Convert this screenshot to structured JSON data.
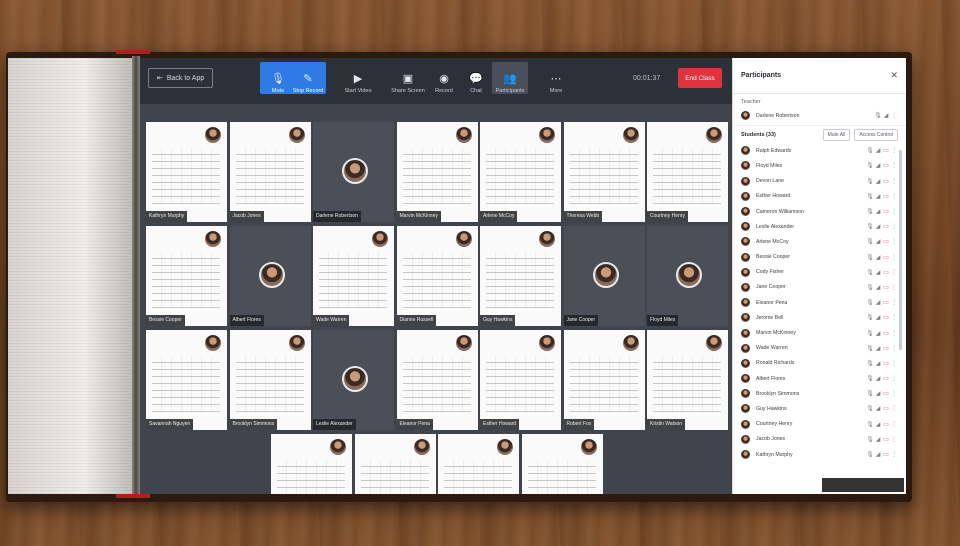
{
  "toolbar": {
    "back_label": "Back to App",
    "tools": [
      {
        "label": "Mute",
        "icon": "microphone-icon",
        "active": true
      },
      {
        "label": "Stop Record",
        "icon": "record-pen-icon",
        "active": true
      },
      {
        "label": "Start Video",
        "icon": "video-camera-icon",
        "active": false
      },
      {
        "label": "Share Screen",
        "icon": "share-screen-icon",
        "active": false
      },
      {
        "label": "Record",
        "icon": "record-icon",
        "active": false
      },
      {
        "label": "Chat",
        "icon": "chat-bubble-icon",
        "active": false
      },
      {
        "label": "Participants",
        "icon": "participants-icon",
        "active": false
      },
      {
        "label": "More",
        "icon": "more-dots-icon",
        "active": false
      }
    ],
    "timer": "00:01:37",
    "end_label": "End Class"
  },
  "grid": {
    "tiles": [
      {
        "name": "Kathryn Murphy",
        "video_off": false
      },
      {
        "name": "Jacob Jones",
        "video_off": false
      },
      {
        "name": "Darlene Robertson",
        "video_off": true
      },
      {
        "name": "Marvin McKinney",
        "video_off": false
      },
      {
        "name": "Arlene McCoy",
        "video_off": false
      },
      {
        "name": "Theresa Webb",
        "video_off": false
      },
      {
        "name": "Courtney Henry",
        "video_off": false
      },
      {
        "name": "Bessie Cooper",
        "video_off": false
      },
      {
        "name": "Albert Flores",
        "video_off": true
      },
      {
        "name": "Wade Warren",
        "video_off": false
      },
      {
        "name": "Dianne Russell",
        "video_off": false
      },
      {
        "name": "Guy Hawkins",
        "video_off": false
      },
      {
        "name": "Jane Cooper",
        "video_off": true
      },
      {
        "name": "Floyd Miles",
        "video_off": true
      },
      {
        "name": "Savannah Nguyen",
        "video_off": false
      },
      {
        "name": "Brooklyn Simmons",
        "video_off": false
      },
      {
        "name": "Leslie Alexander",
        "video_off": true
      },
      {
        "name": "Eleanor Pena",
        "video_off": false
      },
      {
        "name": "Esther Howard",
        "video_off": false
      },
      {
        "name": "Robert Fox",
        "video_off": false
      },
      {
        "name": "Kristin Watson",
        "video_off": false
      },
      {
        "name": "",
        "video_off": false
      },
      {
        "name": "",
        "video_off": false
      },
      {
        "name": "",
        "video_off": false
      },
      {
        "name": "",
        "video_off": false
      }
    ]
  },
  "panel": {
    "title": "Participants",
    "teacher_label": "Teacher",
    "teacher": "Darlene Robertson",
    "students_label": "Students (33)",
    "mute_all": "Mute All",
    "access_control": "Access Control",
    "students": [
      "Ralph Edwards",
      "Floyd Miles",
      "Devon Lane",
      "Esther Howard",
      "Cameron Williamson",
      "Leslie Alexander",
      "Arlene McCoy",
      "Bessie Cooper",
      "Cody Fisher",
      "Jane Cooper",
      "Eleanor Pena",
      "Jerome Bell",
      "Marvin McKinney",
      "Wade Warren",
      "Ronald Richards",
      "Albert Flores",
      "Brooklyn Simmons",
      "Guy Hawkins",
      "Courtney Henry",
      "Jacob Jones",
      "Kathryn Murphy"
    ]
  },
  "colors": {
    "accent": "#2f7be6",
    "end_button": "#e0323f",
    "toolbar_bg": "#2c3038",
    "grid_bg": "#3f444d"
  }
}
